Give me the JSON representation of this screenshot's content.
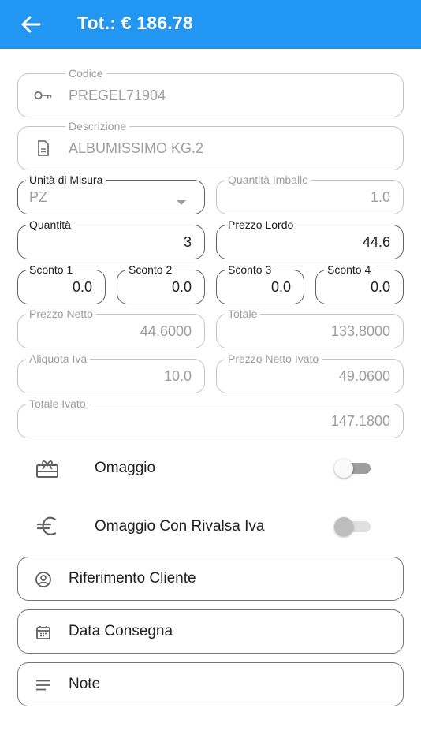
{
  "header": {
    "title": "Tot.: € 186.78",
    "back_icon": "arrow-back-icon",
    "background": "#2196f3"
  },
  "fields": {
    "codice": {
      "label": "Codice",
      "value": "PREGEL71904",
      "icon": "key-icon"
    },
    "descrizione": {
      "label": "Descrizione",
      "value": "ALBUMISSIMO KG.2",
      "icon": "document-icon"
    },
    "unita_misura": {
      "label": "Unità di Misura",
      "value": "PZ",
      "icon": "dropdown-arrow-icon"
    },
    "quantita_imballo": {
      "label": "Quantità Imballo",
      "value": "1.0"
    },
    "quantita": {
      "label": "Quantità",
      "value": "3"
    },
    "prezzo_lordo": {
      "label": "Prezzo Lordo",
      "value": "44.6"
    },
    "sconto1": {
      "label": "Sconto 1",
      "value": "0.0"
    },
    "sconto2": {
      "label": "Sconto 2",
      "value": "0.0"
    },
    "sconto3": {
      "label": "Sconto 3",
      "value": "0.0"
    },
    "sconto4": {
      "label": "Sconto 4",
      "value": "0.0"
    },
    "prezzo_netto": {
      "label": "Prezzo Netto",
      "value": "44.6000"
    },
    "totale": {
      "label": "Totale",
      "value": "133.8000"
    },
    "aliquota_iva": {
      "label": "Aliquota Iva",
      "value": "10.0"
    },
    "prezzo_netto_ivato": {
      "label": "Prezzo Netto Ivato",
      "value": "49.0600"
    },
    "totale_ivato": {
      "label": "Totale Ivato",
      "value": "147.1800"
    }
  },
  "switches": {
    "omaggio": {
      "label": "Omaggio",
      "icon": "gift-card-icon",
      "on": false
    },
    "omaggio_rivalsa": {
      "label": "Omaggio Con Rivalsa Iva",
      "icon": "euro-icon",
      "on": false
    }
  },
  "actions": {
    "riferimento_cliente": {
      "label": "Riferimento Cliente",
      "icon": "account-circle-icon"
    },
    "data_consegna": {
      "label": "Data Consegna",
      "icon": "calendar-icon"
    },
    "note": {
      "label": "Note",
      "icon": "notes-icon"
    }
  },
  "colors": {
    "accent": "#2196f3",
    "border_inactive": "#c4c4c4",
    "border_active": "#616161",
    "text_disabled": "#9e9e9e"
  }
}
